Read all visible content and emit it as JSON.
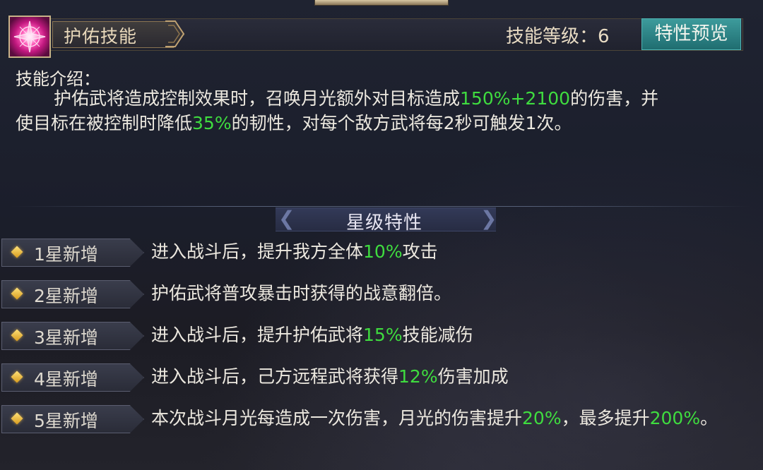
{
  "header": {
    "skill_name": "护佑技能",
    "level_label": "技能等级：6",
    "preview_button": "特性预览"
  },
  "intro": {
    "title": "技能介绍：",
    "line1_a": "护佑武将造成控制效果时，召唤月光额外对目标造成",
    "line1_green": "150%+2100",
    "line1_b": "的伤害，并",
    "line2_a": "使目标在被控制时降低",
    "line2_green": "35%",
    "line2_b": "的韧性，对每个敌方武将每2秒可触发1次。"
  },
  "star_section": {
    "title": "星级特性",
    "rows": [
      {
        "label": "1星新增",
        "text_a": "进入战斗后，提升我方全体",
        "green": "10%",
        "text_b": "攻击"
      },
      {
        "label": "2星新增",
        "text_a": "护佑武将普攻暴击时获得的战意翻倍。",
        "green": "",
        "text_b": ""
      },
      {
        "label": "3星新增",
        "text_a": "进入战斗后，提升护佑武将",
        "green": "15%",
        "text_b": "技能减伤"
      },
      {
        "label": "4星新增",
        "text_a": "进入战斗后，己方远程武将获得",
        "green": "12%",
        "text_b": "伤害加成"
      },
      {
        "label": "5星新增",
        "text_a": "本次战斗月光每造成一次伤害，月光的伤害提升",
        "green": "20%",
        "text_b": "，最多提升",
        "green2": "200%",
        "text_c": "。"
      }
    ]
  },
  "colors": {
    "highlight": "#3fdc3f",
    "preview_button": "#2a8285",
    "icon": "pink-star-burst"
  }
}
